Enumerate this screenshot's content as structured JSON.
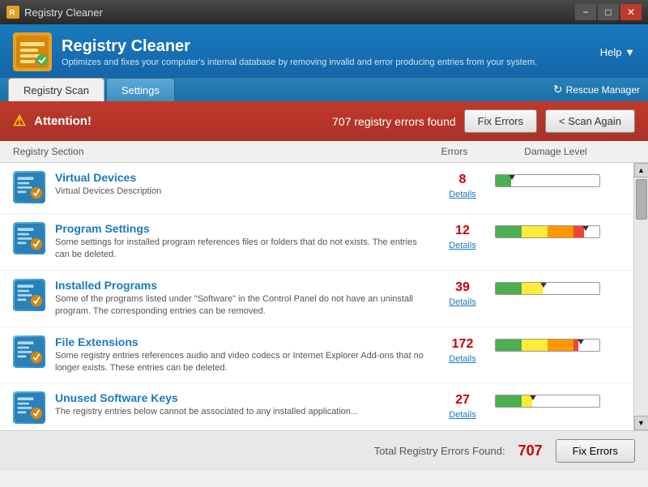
{
  "titleBar": {
    "title": "Registry Cleaner",
    "iconColor": "#e8a020",
    "minBtn": "−",
    "maxBtn": "□",
    "closeBtn": "✕"
  },
  "header": {
    "title": "Registry Cleaner",
    "subtitle": "Optimizes and fixes your computer's internal database by removing invalid and error producing entries from your system.",
    "helpLabel": "Help ▼"
  },
  "tabs": [
    {
      "id": "registry-scan",
      "label": "Registry Scan",
      "active": true
    },
    {
      "id": "settings",
      "label": "Settings",
      "active": false
    }
  ],
  "rescueManager": {
    "label": "Rescue Manager"
  },
  "alert": {
    "icon": "⚠",
    "boldText": "Attention!",
    "message": "707 registry errors found",
    "fixErrorsLabel": "Fix Errors",
    "scanAgainLabel": "< Scan Again"
  },
  "columns": {
    "section": "Registry Section",
    "errors": "Errors",
    "damage": "Damage Level"
  },
  "items": [
    {
      "id": "virtual-devices",
      "title": "Virtual Devices",
      "description": "Virtual Devices Description",
      "errors": 8,
      "detailsLabel": "Details",
      "damagePercent": 15
    },
    {
      "id": "program-settings",
      "title": "Program Settings",
      "description": "Some settings for installed program references files or folders that do not exists. The entries can be deleted.",
      "errors": 12,
      "detailsLabel": "Details",
      "damagePercent": 85
    },
    {
      "id": "installed-programs",
      "title": "Installed Programs",
      "description": "Some of the programs listed under \"Software\" in the Control Panel do not have an uninstall program. The corresponding entries can be removed.",
      "errors": 39,
      "detailsLabel": "Details",
      "damagePercent": 45
    },
    {
      "id": "file-extensions",
      "title": "File Extensions",
      "description": "Some registry entries references audio and video codecs or Internet Explorer Add-ons that no longer exists. These entries can be deleted.",
      "errors": 172,
      "detailsLabel": "Details",
      "damagePercent": 80
    },
    {
      "id": "unused-software-keys",
      "title": "Unused Software Keys",
      "description": "The registry entries below cannot be associated to any installed application...",
      "errors": 27,
      "detailsLabel": "Details",
      "damagePercent": 35
    }
  ],
  "footer": {
    "label": "Total Registry Errors Found:",
    "count": "707",
    "fixErrorsLabel": "Fix Errors"
  }
}
